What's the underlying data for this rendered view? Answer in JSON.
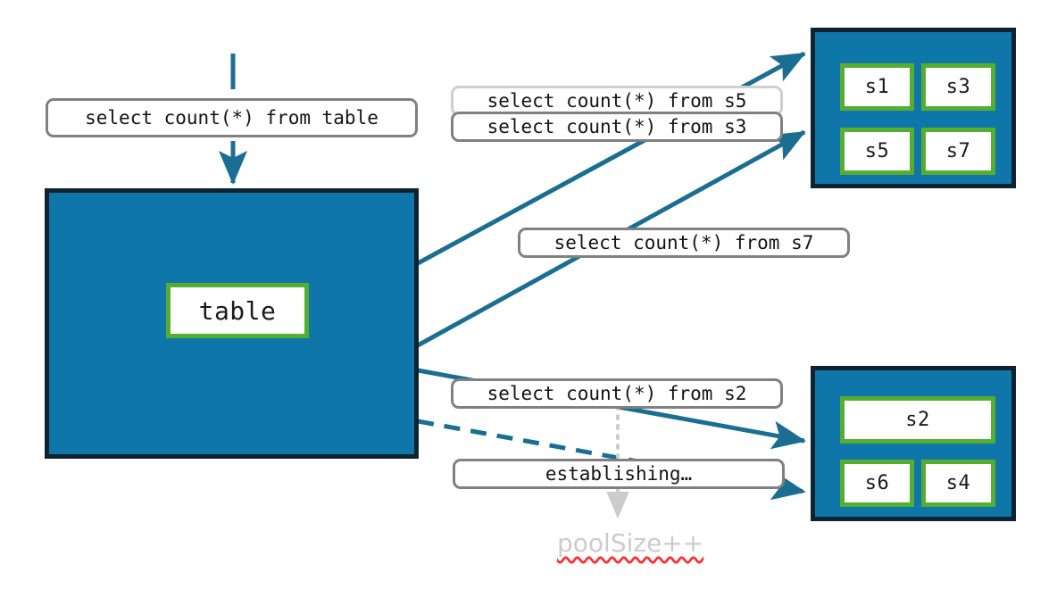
{
  "diagram": {
    "title": "connection-pool-query-routing",
    "colors": {
      "container_fill": "#0E76A8",
      "container_border": "#0D2330",
      "node_border": "#55AE30",
      "node_fill": "#FFFFFF",
      "wire": "#1A6E92",
      "pill_border": "#808080",
      "pill_border_faded": "#CFCFCF",
      "annotation_text": "#CCCCCC",
      "spellcheck_underline": "#FF2D2D"
    }
  },
  "source": {
    "name": "table-container",
    "node_label": "table"
  },
  "pools": {
    "top": {
      "name": "connection-pool-top",
      "nodes": [
        {
          "label": "s1"
        },
        {
          "label": "s3"
        },
        {
          "label": "s5"
        },
        {
          "label": "s7"
        }
      ]
    },
    "bottom": {
      "name": "connection-pool-bottom",
      "nodes": [
        {
          "label": "s2"
        },
        {
          "label": "s6"
        },
        {
          "label": "s4"
        }
      ]
    }
  },
  "labels": {
    "incoming_query": "select count(*) from table",
    "query_s5": "select count(*) from s5",
    "query_s3": "select count(*) from s3",
    "query_s7": "select count(*) from s7",
    "query_s2": "select count(*) from s2",
    "establishing": "establishing…",
    "pool_size_increment": "poolSize++"
  }
}
